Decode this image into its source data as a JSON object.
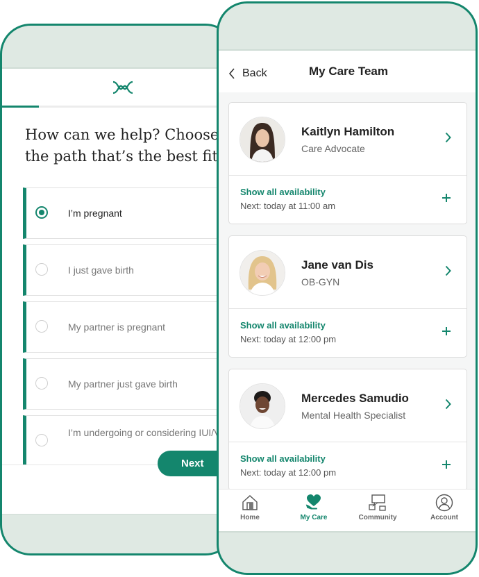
{
  "left": {
    "question": [
      "How can we help? Choose",
      "the path that’s the best fit"
    ],
    "progress": 0.16,
    "options": [
      {
        "label": "I’m pregnant",
        "selected": true
      },
      {
        "label": "I just gave birth",
        "selected": false
      },
      {
        "label": "My partner is pregnant",
        "selected": false
      },
      {
        "label": "My partner just gave birth",
        "selected": false
      },
      {
        "label": "I’m undergoing or considering IUI/VF",
        "selected": false
      }
    ],
    "next_label": "Next"
  },
  "right": {
    "back_label": "Back",
    "title": "My Care Team",
    "members": [
      {
        "name": "Kaitlyn Hamilton",
        "role": "Care Advocate",
        "availability_label": "Show all availability",
        "next_slot": "Next: today at 11:00 am"
      },
      {
        "name": "Jane van Dis",
        "role": "OB-GYN",
        "availability_label": "Show all availability",
        "next_slot": "Next: today at 12:00 pm"
      },
      {
        "name": "Mercedes Samudio",
        "role": "Mental Health Specialist",
        "availability_label": "Show all availability",
        "next_slot": "Next: today at 12:00 pm"
      }
    ],
    "tabs": [
      {
        "label": "Home",
        "icon": "home-icon",
        "active": false
      },
      {
        "label": "My Care",
        "icon": "heart-hand-icon",
        "active": true
      },
      {
        "label": "Community",
        "icon": "chat-icon",
        "active": false
      },
      {
        "label": "Account",
        "icon": "account-icon",
        "active": false
      }
    ]
  },
  "colors": {
    "accent": "#14866d",
    "bezel": "#dfe9e3"
  }
}
